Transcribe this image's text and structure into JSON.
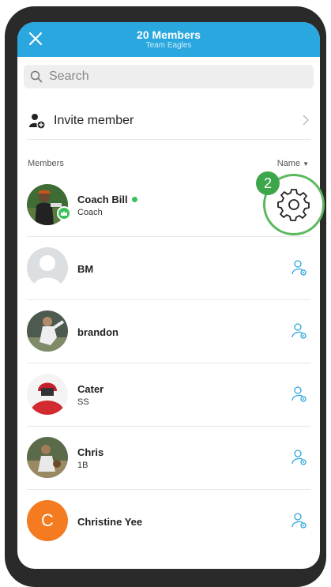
{
  "header": {
    "title": "20 Members",
    "subtitle": "Team Eagles"
  },
  "search": {
    "placeholder": "Search",
    "value": ""
  },
  "invite": {
    "label": "Invite member"
  },
  "members_section": {
    "label": "Members",
    "sort_label": "Name"
  },
  "members": [
    {
      "name": "Coach Bill",
      "role": "Coach",
      "online": true,
      "avatar": "photo-coach"
    },
    {
      "name": "BM",
      "role": "",
      "avatar": "placeholder"
    },
    {
      "name": "brandon",
      "role": "",
      "avatar": "photo-pitcher"
    },
    {
      "name": "Cater",
      "role": "SS",
      "avatar": "photo-red-hoodie"
    },
    {
      "name": "Chris",
      "role": "1B",
      "avatar": "photo-fielder"
    },
    {
      "name": "Christine Yee",
      "role": "",
      "avatar": "letter",
      "initial": "C"
    }
  ],
  "callout": {
    "step": "2",
    "icon": "gear-icon"
  },
  "colors": {
    "header_bg": "#2aa7df",
    "online": "#3cc05a",
    "callout": "#5bb85d",
    "letter_avatar": "#f47b20",
    "perm_icon": "#2aa7df"
  }
}
